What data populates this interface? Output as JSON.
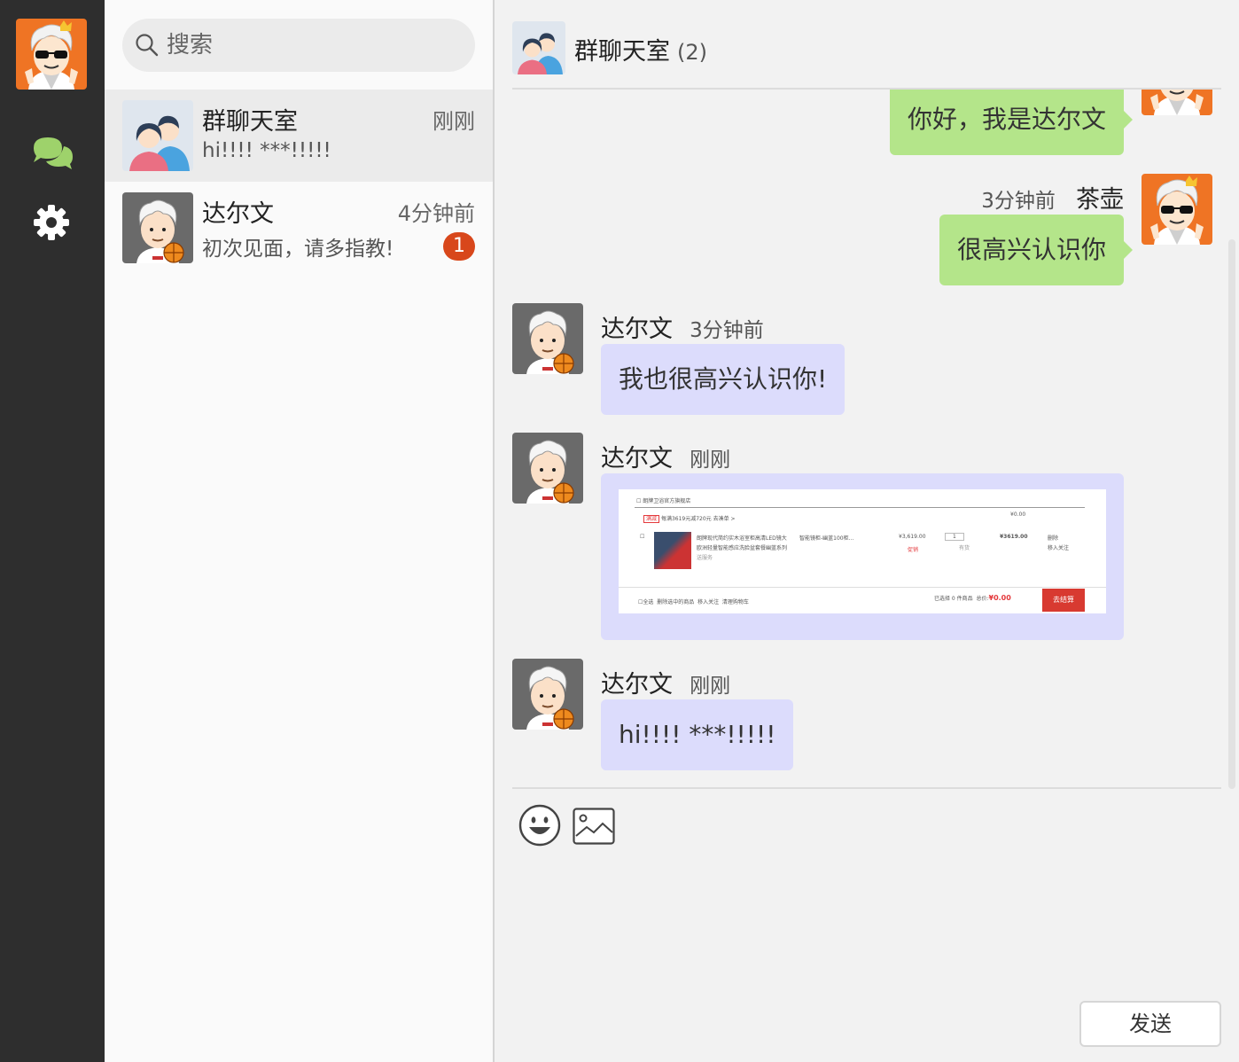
{
  "sidebar": {
    "avatar_icon": "user-avatar-sunglasses-icon",
    "nav": [
      {
        "icon": "chat-bubbles-icon",
        "active": true,
        "color": "#9ed26b"
      },
      {
        "icon": "gear-icon",
        "active": false,
        "color": "#ffffff"
      }
    ]
  },
  "search": {
    "placeholder": "搜索"
  },
  "sessions": [
    {
      "name": "群聊天室",
      "time": "刚刚",
      "last_message": "hi!!!! ***!!!!!",
      "unread": "",
      "avatar": "group-avatar-icon",
      "active": true
    },
    {
      "name": "达尔文",
      "time": "4分钟前",
      "last_message": "初次见面，请多指教!",
      "unread": "1",
      "avatar": "darwin-avatar-icon",
      "active": false
    }
  ],
  "chat": {
    "title": "群聊天室",
    "member_count": "(2)",
    "messages": [
      {
        "from": "me",
        "name": "",
        "time": "",
        "type": "text",
        "text": "你好，我是达尔文"
      },
      {
        "from": "me",
        "name": "茶壶",
        "time": "3分钟前",
        "type": "text",
        "text": "很高兴认识你"
      },
      {
        "from": "other",
        "name": "达尔文",
        "time": "3分钟前",
        "type": "text",
        "text": "我也很高兴认识你!"
      },
      {
        "from": "other",
        "name": "达尔文",
        "time": "刚刚",
        "type": "image",
        "image": {
          "shop": "朗牌卫浴官方旗舰店",
          "promo_tag": "满减",
          "promo_text": "每满3619元减720元 去凑单 >",
          "top_total": "¥0.00",
          "product_title_1": "朗牌现代简约实木浴室柜高清LED镜大",
          "product_title_2": "欧洲轻量智能感应洗脸盆套餐幽蓝系列",
          "product_spec": "智能镜柜-幽蓝100柜...",
          "unit_price": "¥3,619.00",
          "promo_select": "促销",
          "qty": "1",
          "stock": "有货",
          "subtotal": "¥3619.00",
          "action_delete": "删除",
          "action_follow": "移入关注",
          "service": "送服务",
          "footer_select_all": "全选",
          "footer_delete": "删除选中的商品",
          "footer_follow": "移入关注",
          "footer_clear": "清理购物车",
          "footer_selected": "已选择 0 件商品",
          "footer_total_label": "总价:",
          "footer_total": "¥0.00",
          "checkout": "去结算"
        }
      },
      {
        "from": "other",
        "name": "达尔文",
        "time": "刚刚",
        "type": "text",
        "text": "hi!!!! ***!!!!!"
      }
    ]
  },
  "composer": {
    "tools": [
      {
        "icon": "emoji-icon"
      },
      {
        "icon": "image-icon"
      }
    ],
    "send_label": "发送"
  },
  "colors": {
    "rail_bg": "#2e2e2e",
    "my_bubble": "#b4e58a",
    "other_bubble": "#dcdcfc",
    "badge": "#d8471b",
    "avatar_orange": "#ef7424"
  }
}
